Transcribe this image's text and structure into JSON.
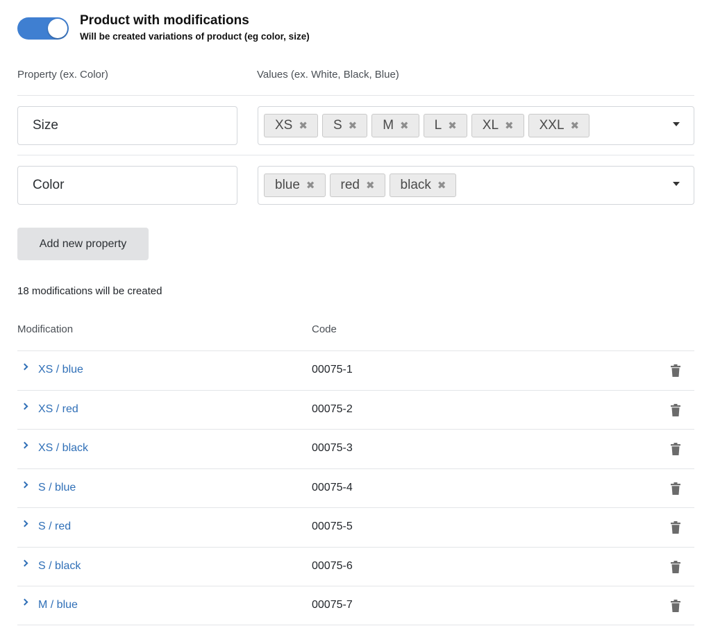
{
  "header": {
    "title": "Product with modifications",
    "subtitle": "Will be created variations of product (eg color, size)",
    "toggle_on": true,
    "toggle_color": "#3f7fd1"
  },
  "properties_section": {
    "property_label": "Property (ex. Color)",
    "values_label": "Values (ex. White, Black, Blue)",
    "rows": [
      {
        "name": "Size",
        "values": [
          "XS",
          "S",
          "M",
          "L",
          "XL",
          "XXL"
        ]
      },
      {
        "name": "Color",
        "values": [
          "blue",
          "red",
          "black"
        ]
      }
    ],
    "remove_icon": "✖",
    "dropdown_icon": "caret-down-icon",
    "add_button_label": "Add new property"
  },
  "modifications": {
    "count_text": "18 modifications will be created",
    "columns": {
      "modification": "Modification",
      "code": "Code"
    },
    "link_color": "#2f6fb7",
    "expand_icon": "chevron-right-icon",
    "delete_icon": "trash-icon",
    "rows": [
      {
        "name": "XS / blue",
        "code": "00075-1"
      },
      {
        "name": "XS / red",
        "code": "00075-2"
      },
      {
        "name": "XS / black",
        "code": "00075-3"
      },
      {
        "name": "S / blue",
        "code": "00075-4"
      },
      {
        "name": "S / red",
        "code": "00075-5"
      },
      {
        "name": "S / black",
        "code": "00075-6"
      },
      {
        "name": "M / blue",
        "code": "00075-7"
      }
    ]
  }
}
